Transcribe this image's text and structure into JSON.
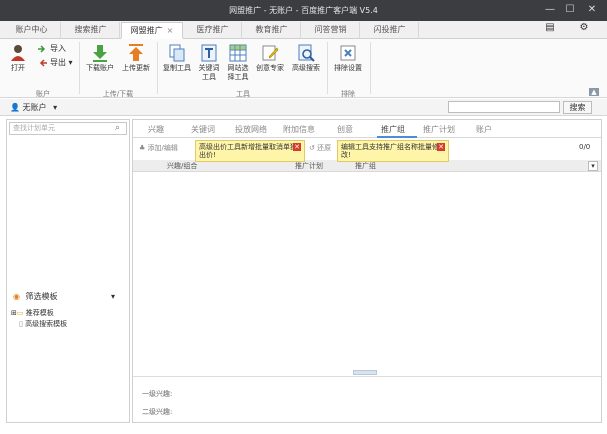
{
  "window": {
    "title": "网盟推广 - 无账户 - 百度推广客户端 V5.4"
  },
  "tabs": [
    {
      "label": "账户中心"
    },
    {
      "label": "搜索推广"
    },
    {
      "label": "网盟推广",
      "active": true
    },
    {
      "label": "医疗推广"
    },
    {
      "label": "教育推广"
    },
    {
      "label": "问答营销"
    },
    {
      "label": "闪投推广"
    }
  ],
  "tab_close_glyph": "×",
  "ribbon": {
    "account": {
      "open": "打开",
      "import": "导入",
      "export": "导出",
      "group": "账户"
    },
    "updown": {
      "download": "下载账户",
      "upload": "上传更新",
      "group": "上传/下载"
    },
    "tools": {
      "copy": "复制工具",
      "keyword": [
        "关键词",
        "工具"
      ],
      "site_select": [
        "网站选",
        "择工具"
      ],
      "creative": "创意专家",
      "advanced_search": "高级搜索",
      "group": "工具"
    },
    "exclude": {
      "settings": "排除设置",
      "group": "排除"
    }
  },
  "accountbar": {
    "account_label": "无账户",
    "search_btn": "搜索"
  },
  "leftpanel": {
    "search_placeholder": "查找计划单元",
    "filter_title": "筛选模板",
    "tree": [
      "推荐模板",
      "高级搜索模板"
    ]
  },
  "main": {
    "subtabs": [
      "兴趣",
      "关键词",
      "投放网络",
      "附加信息",
      "创意",
      "推广组",
      "推广计划",
      "账户"
    ],
    "active_subtab": "推广组",
    "toolbar": {
      "add_edit": "添加/编辑",
      "restore": "还原",
      "count": "0/0"
    },
    "tips": [
      "高级出价工具新增批量取消单独出价!",
      "编辑工具支持推广组名称批量修改!"
    ],
    "columns": [
      "兴趣/组合",
      "推广计划",
      "推广组"
    ],
    "detail": {
      "level1": "一级兴趣:",
      "level2": "二级兴趣:"
    }
  },
  "colors": {
    "titlebar": "#3b3d40",
    "accent": "#4c8ed6",
    "tip_bg": "#fff5a8"
  }
}
